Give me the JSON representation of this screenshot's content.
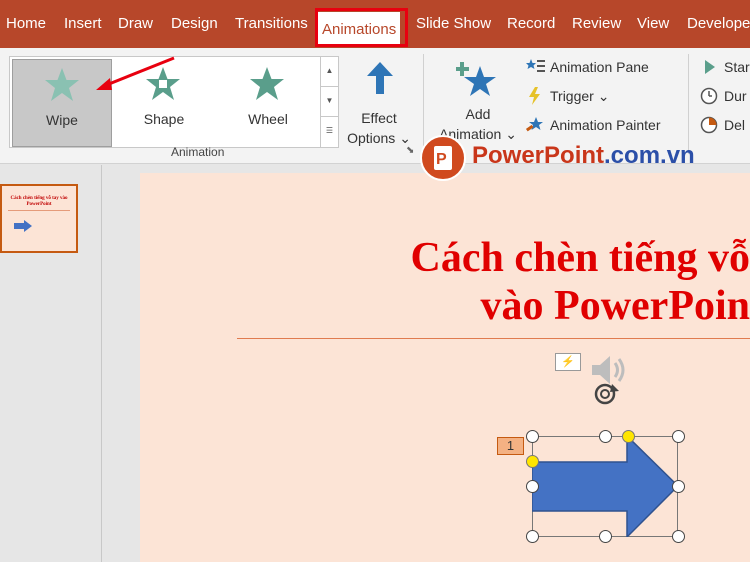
{
  "tabs": [
    {
      "label": "Home"
    },
    {
      "label": "Insert"
    },
    {
      "label": "Draw"
    },
    {
      "label": "Design"
    },
    {
      "label": "Transitions"
    },
    {
      "label": "Animations"
    },
    {
      "label": "Slide Show"
    },
    {
      "label": "Record"
    },
    {
      "label": "Review"
    },
    {
      "label": "View"
    },
    {
      "label": "Develope"
    }
  ],
  "active_tab": "Animations",
  "gallery": {
    "items": [
      {
        "label": "Wipe"
      },
      {
        "label": "Shape"
      },
      {
        "label": "Wheel"
      }
    ],
    "selected": "Wipe"
  },
  "effect_options": {
    "line1": "Effect",
    "line2": "Options ⌄"
  },
  "group_animation_label": "Animation",
  "add_animation": {
    "line1": "Add",
    "line2": "Animation ⌄"
  },
  "advanced": {
    "animation_pane": "Animation Pane",
    "trigger": "Trigger ⌄",
    "animation_painter": "Animation Painter"
  },
  "timing": {
    "start": "Star",
    "duration": "Dur",
    "delay": "Del"
  },
  "watermark": {
    "part1": "PowerPoint",
    "part2": ".com.vn"
  },
  "thumbnail": {
    "number": "",
    "text": "Cách chèn tiếng vỗ tay vào PowerPoint"
  },
  "slide": {
    "title_line1": "Cách chèn tiếng vỗ",
    "title_line2": "vào PowerPoin",
    "animation_tag": "1"
  },
  "colors": {
    "accent": "#b7472a",
    "highlight_red": "#e8000f",
    "slide_bg": "#fce4d6",
    "title_red": "#e00000",
    "arrow_blue": "#4472c4"
  }
}
